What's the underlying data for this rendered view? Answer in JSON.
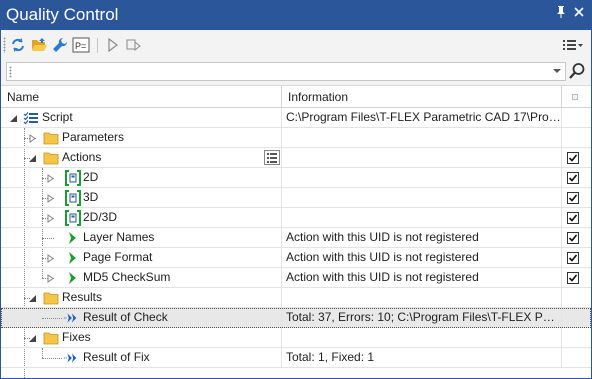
{
  "window": {
    "title": "Quality Control"
  },
  "toolbar": {
    "buttons": [
      "refresh-icon",
      "open-folder-icon",
      "wrench-icon",
      "parameters-icon",
      "run-icon",
      "run-step-icon"
    ],
    "view_menu_icon": "list-view-icon"
  },
  "search": {
    "value": "",
    "placeholder": ""
  },
  "columns": {
    "name": "Name",
    "information": "Information"
  },
  "rows": [
    {
      "label": "Script",
      "info": "C:\\Program Files\\T-FLEX Parametric CAD 17\\Progr...",
      "icon": "script-icon",
      "checkbox": false
    },
    {
      "label": "Parameters",
      "info": "",
      "icon": "folder-icon",
      "checkbox": false
    },
    {
      "label": "Actions",
      "info": "",
      "icon": "folder-icon",
      "checkbox": true,
      "checked": true
    },
    {
      "label": "2D",
      "info": "",
      "icon": "group-icon",
      "checkbox": true,
      "checked": true
    },
    {
      "label": "3D",
      "info": "",
      "icon": "group-icon",
      "checkbox": true,
      "checked": true
    },
    {
      "label": "2D/3D",
      "info": "",
      "icon": "group-icon",
      "checkbox": true,
      "checked": true
    },
    {
      "label": "Layer Names",
      "info": "Action with this UID is not registered",
      "icon": "action-arrow-icon",
      "checkbox": true,
      "checked": true
    },
    {
      "label": "Page Format",
      "info": "Action with this UID is not registered",
      "icon": "action-arrow-icon",
      "checkbox": true,
      "checked": true
    },
    {
      "label": "MD5 CheckSum",
      "info": "Action with this UID is not registered",
      "icon": "action-arrow-icon",
      "checkbox": true,
      "checked": true
    },
    {
      "label": "Results",
      "info": "",
      "icon": "folder-icon",
      "checkbox": false
    },
    {
      "label": "Result of Check",
      "info": "Total: 37, Errors: 10; C:\\Program Files\\T-FLEX Para...",
      "icon": "result-arrow-icon",
      "checkbox": false,
      "selected": true
    },
    {
      "label": "Fixes",
      "info": "",
      "icon": "folder-icon",
      "checkbox": false
    },
    {
      "label": "Result of Fix",
      "info": "Total: 1, Fixed: 1",
      "icon": "result-arrow-icon",
      "checkbox": false
    }
  ],
  "colors": {
    "title_bar": "#2b579a",
    "folder": "#f3c54a",
    "action_green": "#1d9d31",
    "result_blue": "#1f5fb4"
  }
}
